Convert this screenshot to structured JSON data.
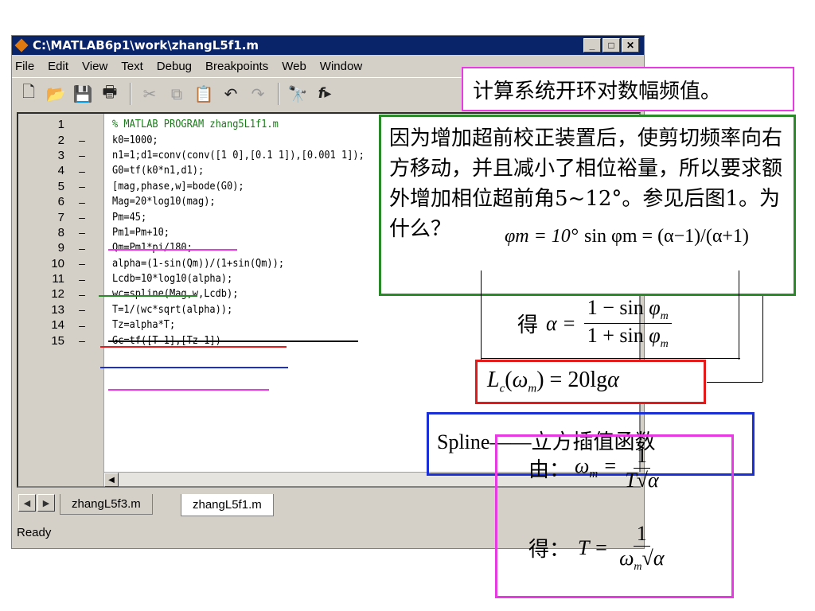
{
  "window": {
    "title": "C:\\MATLAB6p1\\work\\zhangL5f1.m",
    "controls": {
      "minimize": "_",
      "maximize": "□",
      "close": "✕"
    }
  },
  "menu": [
    "File",
    "Edit",
    "View",
    "Text",
    "Debug",
    "Breakpoints",
    "Web",
    "Window"
  ],
  "toolbar": {
    "icons": [
      "new-file-icon",
      "open-folder-icon",
      "save-icon",
      "print-icon",
      "cut-icon",
      "copy-icon",
      "paste-icon",
      "undo-icon",
      "redo-icon",
      "find-icon",
      "function-icon"
    ]
  },
  "code_lines": [
    {
      "n": "1",
      "mark": "",
      "text": "% MATLAB PROGRAM zhang5L1f1.m"
    },
    {
      "n": "2",
      "mark": "–",
      "text": "k0=1000;"
    },
    {
      "n": "3",
      "mark": "–",
      "text": "n1=1;d1=conv(conv([1 0],[0.1 1]),[0.001 1]);"
    },
    {
      "n": "4",
      "mark": "–",
      "text": "G0=tf(k0*n1,d1);"
    },
    {
      "n": "5",
      "mark": "–",
      "text": "[mag,phase,w]=bode(G0);"
    },
    {
      "n": "6",
      "mark": "–",
      "text": "Mag=20*log10(mag);"
    },
    {
      "n": "7",
      "mark": "–",
      "text": "Pm=45;"
    },
    {
      "n": "8",
      "mark": "–",
      "text": "Pm1=Pm+10;"
    },
    {
      "n": "9",
      "mark": "–",
      "text": "Qm=Pm1*pi/180;"
    },
    {
      "n": "10",
      "mark": "–",
      "text": "alpha=(1-sin(Qm))/(1+sin(Qm));"
    },
    {
      "n": "11",
      "mark": "–",
      "text": "Lcdb=10*log10(alpha);"
    },
    {
      "n": "12",
      "mark": "–",
      "text": "wc=spline(Mag,w,Lcdb);"
    },
    {
      "n": "13",
      "mark": "–",
      "text": "T=1/(wc*sqrt(alpha));"
    },
    {
      "n": "14",
      "mark": "–",
      "text": "Tz=alpha*T;"
    },
    {
      "n": "15",
      "mark": "–",
      "text": "Gc=tf([T 1],[Tz 1])"
    }
  ],
  "tabs": [
    "zhangL5f3.m",
    "zhangL5f1.m"
  ],
  "status": "Ready",
  "annotations": {
    "magnitude_note": "计算系统开环对数幅频值。",
    "phase_note": "因为增加超前校正装置后，使剪切频率向右方移动，并且减小了相位裕量，所以要求额外增加相位超前角5~12°。参见后图1。为什么？",
    "phase_note_formula": "φm = 10°",
    "sin_formula": "sin φm = (α−1)/(α+1)",
    "alpha_prefix": "得",
    "alpha_formula": "α = (1−sin φm)/(1+sin φm)",
    "lc_formula": "Lc(ωm) = 20lg α",
    "spline_note": "Spline——立方插值函数",
    "omega_prefix": "由：",
    "omega_formula": "ωm = 1/(T√α)",
    "t_prefix": "得：",
    "t_formula": "T = 1/(ωm√α)"
  },
  "colors": {
    "magenta": "#e83ae3",
    "green": "#2a8a2a",
    "red": "#e21a1a",
    "blue": "#1b2fd6",
    "black": "#000000",
    "title_bar": "#0a246a"
  }
}
